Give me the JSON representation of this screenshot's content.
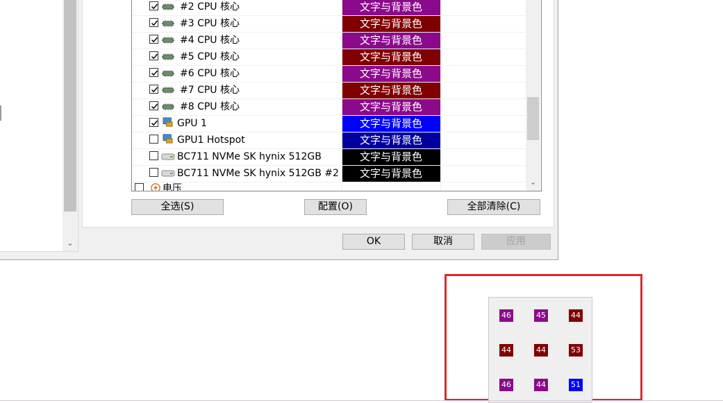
{
  "sensor_list": {
    "color_label": "文字与背景色",
    "rows": [
      {
        "label": "#2 CPU 核心",
        "checked": true,
        "icon": "cpu-core-icon",
        "color": "#8b0a8b"
      },
      {
        "label": "#3 CPU 核心",
        "checked": true,
        "icon": "cpu-core-icon",
        "color": "#800000"
      },
      {
        "label": "#4 CPU 核心",
        "checked": true,
        "icon": "cpu-core-icon",
        "color": "#8b0a8b"
      },
      {
        "label": "#5 CPU 核心",
        "checked": true,
        "icon": "cpu-core-icon",
        "color": "#800000"
      },
      {
        "label": "#6 CPU 核心",
        "checked": true,
        "icon": "cpu-core-icon",
        "color": "#8b0a8b"
      },
      {
        "label": "#7 CPU 核心",
        "checked": true,
        "icon": "cpu-core-icon",
        "color": "#800000"
      },
      {
        "label": "#8 CPU 核心",
        "checked": true,
        "icon": "cpu-core-icon",
        "color": "#8b0a8b"
      },
      {
        "label": "GPU 1",
        "checked": true,
        "icon": "gpu-icon",
        "color": "#0000ff"
      },
      {
        "label": "GPU1 Hotspot",
        "checked": false,
        "icon": "gpu-icon",
        "color": "#0000a0"
      },
      {
        "label": "BC711 NVMe SK hynix 512GB",
        "checked": false,
        "icon": "drive-icon",
        "color": "#000000"
      },
      {
        "label": "BC711 NVMe SK hynix 512GB #2",
        "checked": false,
        "icon": "drive-icon",
        "color": "#000000"
      }
    ],
    "category_voltage": "电压"
  },
  "buttons": {
    "select_all": "全选(S)",
    "configure": "配置(O)",
    "clear_all": "全部清除(C)",
    "ok": "OK",
    "cancel": "取消",
    "apply": "应用"
  },
  "tray": {
    "values": [
      {
        "value": "46",
        "color": "#8b0a8b"
      },
      {
        "value": "45",
        "color": "#8b0a8b"
      },
      {
        "value": "44",
        "color": "#800000"
      },
      {
        "value": "44",
        "color": "#800000"
      },
      {
        "value": "44",
        "color": "#800000"
      },
      {
        "value": "53",
        "color": "#800000"
      },
      {
        "value": "46",
        "color": "#8b0a8b"
      },
      {
        "value": "44",
        "color": "#8b0a8b"
      },
      {
        "value": "51",
        "color": "#0000ff"
      }
    ]
  },
  "colors": {
    "highlight": "#e0272e"
  }
}
